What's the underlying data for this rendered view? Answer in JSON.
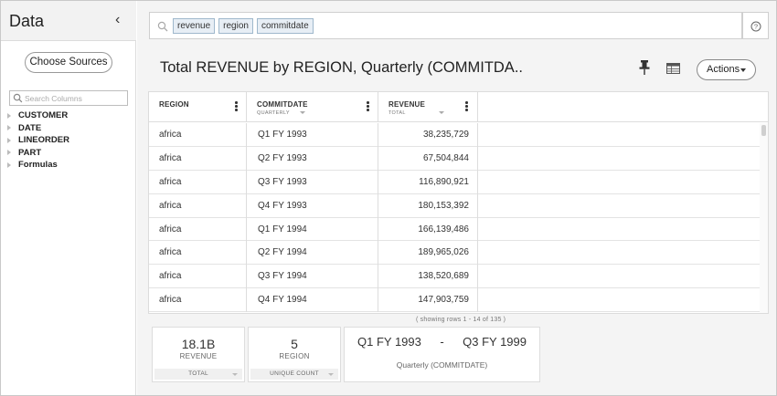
{
  "sidebar": {
    "title": "Data",
    "choose_sources_label": "Choose Sources",
    "search_placeholder": "Search Columns",
    "sources": [
      "CUSTOMER",
      "DATE",
      "LINEORDER",
      "PART",
      "Formulas"
    ]
  },
  "search": {
    "tokens": [
      "revenue",
      "region",
      "commitdate"
    ]
  },
  "header": {
    "title": "Total REVENUE by REGION, Quarterly (COMMITDA..",
    "actions_label": "Actions"
  },
  "table": {
    "columns": [
      {
        "label": "REGION",
        "sub": ""
      },
      {
        "label": "COMMITDATE",
        "sub": "QUARTERLY"
      },
      {
        "label": "REVENUE",
        "sub": "TOTAL"
      }
    ],
    "rows": [
      [
        "africa",
        "Q1 FY 1993",
        "38,235,729"
      ],
      [
        "africa",
        "Q2 FY 1993",
        "67,504,844"
      ],
      [
        "africa",
        "Q3 FY 1993",
        "116,890,921"
      ],
      [
        "africa",
        "Q4 FY 1993",
        "180,153,392"
      ],
      [
        "africa",
        "Q1 FY 1994",
        "166,139,486"
      ],
      [
        "africa",
        "Q2 FY 1994",
        "189,965,026"
      ],
      [
        "africa",
        "Q3 FY 1994",
        "138,520,689"
      ],
      [
        "africa",
        "Q4 FY 1994",
        "147,903,759"
      ]
    ],
    "row_info": "( showing rows 1 - 14 of 135 )"
  },
  "summary": {
    "revenue": {
      "value": "18.1B",
      "label": "REVENUE",
      "footer": "TOTAL"
    },
    "region": {
      "value": "5",
      "label": "REGION",
      "footer": "UNIQUE COUNT"
    },
    "commitdate": {
      "start": "Q1 FY 1993",
      "separator": "-",
      "end": "Q3 FY 1999",
      "label": "Quarterly (COMMITDATE)"
    }
  }
}
